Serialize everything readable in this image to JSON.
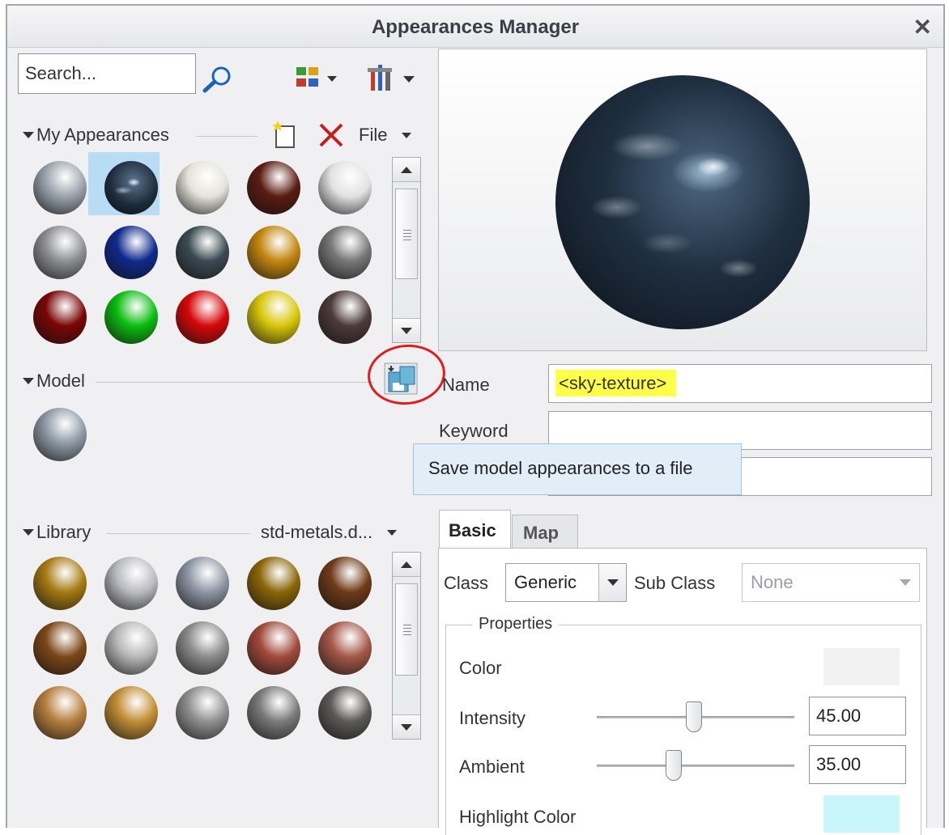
{
  "window": {
    "title": "Appearances Manager",
    "close_glyph": "✕"
  },
  "toolbar": {
    "search_placeholder": "Search...",
    "search_icon": "magnifier-icon",
    "view_icon": "thumbnail-view-icon",
    "tools_icon": "tools-icon"
  },
  "my_appearances": {
    "label": "My Appearances",
    "file_label": "File",
    "new_icon": "new-appearance-icon",
    "delete_icon": "delete-icon",
    "spheres": [
      "#9aa3ad",
      "sky",
      "#e5e3da",
      "#5a1c12",
      "#e2e2e2",
      "#8d8f93",
      "#0f2a8c",
      "#3b4a52",
      "#c2860f",
      "#777",
      "#7a0606",
      "#0bbd10",
      "#d60808",
      "#d7c60a",
      "#4d3b3a"
    ],
    "selected_index": 1
  },
  "model": {
    "label": "Model",
    "save_icon": "save-model-appearances-icon",
    "spheres": [
      "#8e9aa6"
    ]
  },
  "library": {
    "label": "Library",
    "dropdown": "std-metals.d...",
    "spheres": [
      "#a67a12",
      "#b9bcc0",
      "#8e96a4",
      "#8a6608",
      "#6e3b18",
      "#7c4718",
      "#b8b8b8",
      "#8b8b8b",
      "#a04a3a",
      "#a45848",
      "#b6803e",
      "#c08e34",
      "#909090",
      "#7a7a7a",
      "#5c5a56"
    ]
  },
  "detail": {
    "name_label": "Name",
    "name_value": "<sky-texture>",
    "keyword_label": "Keyword",
    "keyword_value": "",
    "third_value": "",
    "tooltip": "Save model appearances to a file"
  },
  "tabs": {
    "basic": "Basic",
    "map": "Map",
    "active": "Basic"
  },
  "basic": {
    "class_label": "Class",
    "class_value": "Generic",
    "subclass_label": "Sub Class",
    "subclass_value": "None",
    "properties_label": "Properties",
    "color_label": "Color",
    "color_value": "#f2f2f2",
    "intensity_label": "Intensity",
    "intensity_value": "45.00",
    "intensity_fraction": 0.45,
    "ambient_label": "Ambient",
    "ambient_value": "35.00",
    "ambient_fraction": 0.35,
    "highlight_label": "Highlight Color",
    "highlight_value": "#c8f6fb"
  },
  "colors": {
    "selection": "#b9dcf5",
    "annotation_red": "#e01c1c",
    "highlight_yellow": "#ffff4a"
  }
}
